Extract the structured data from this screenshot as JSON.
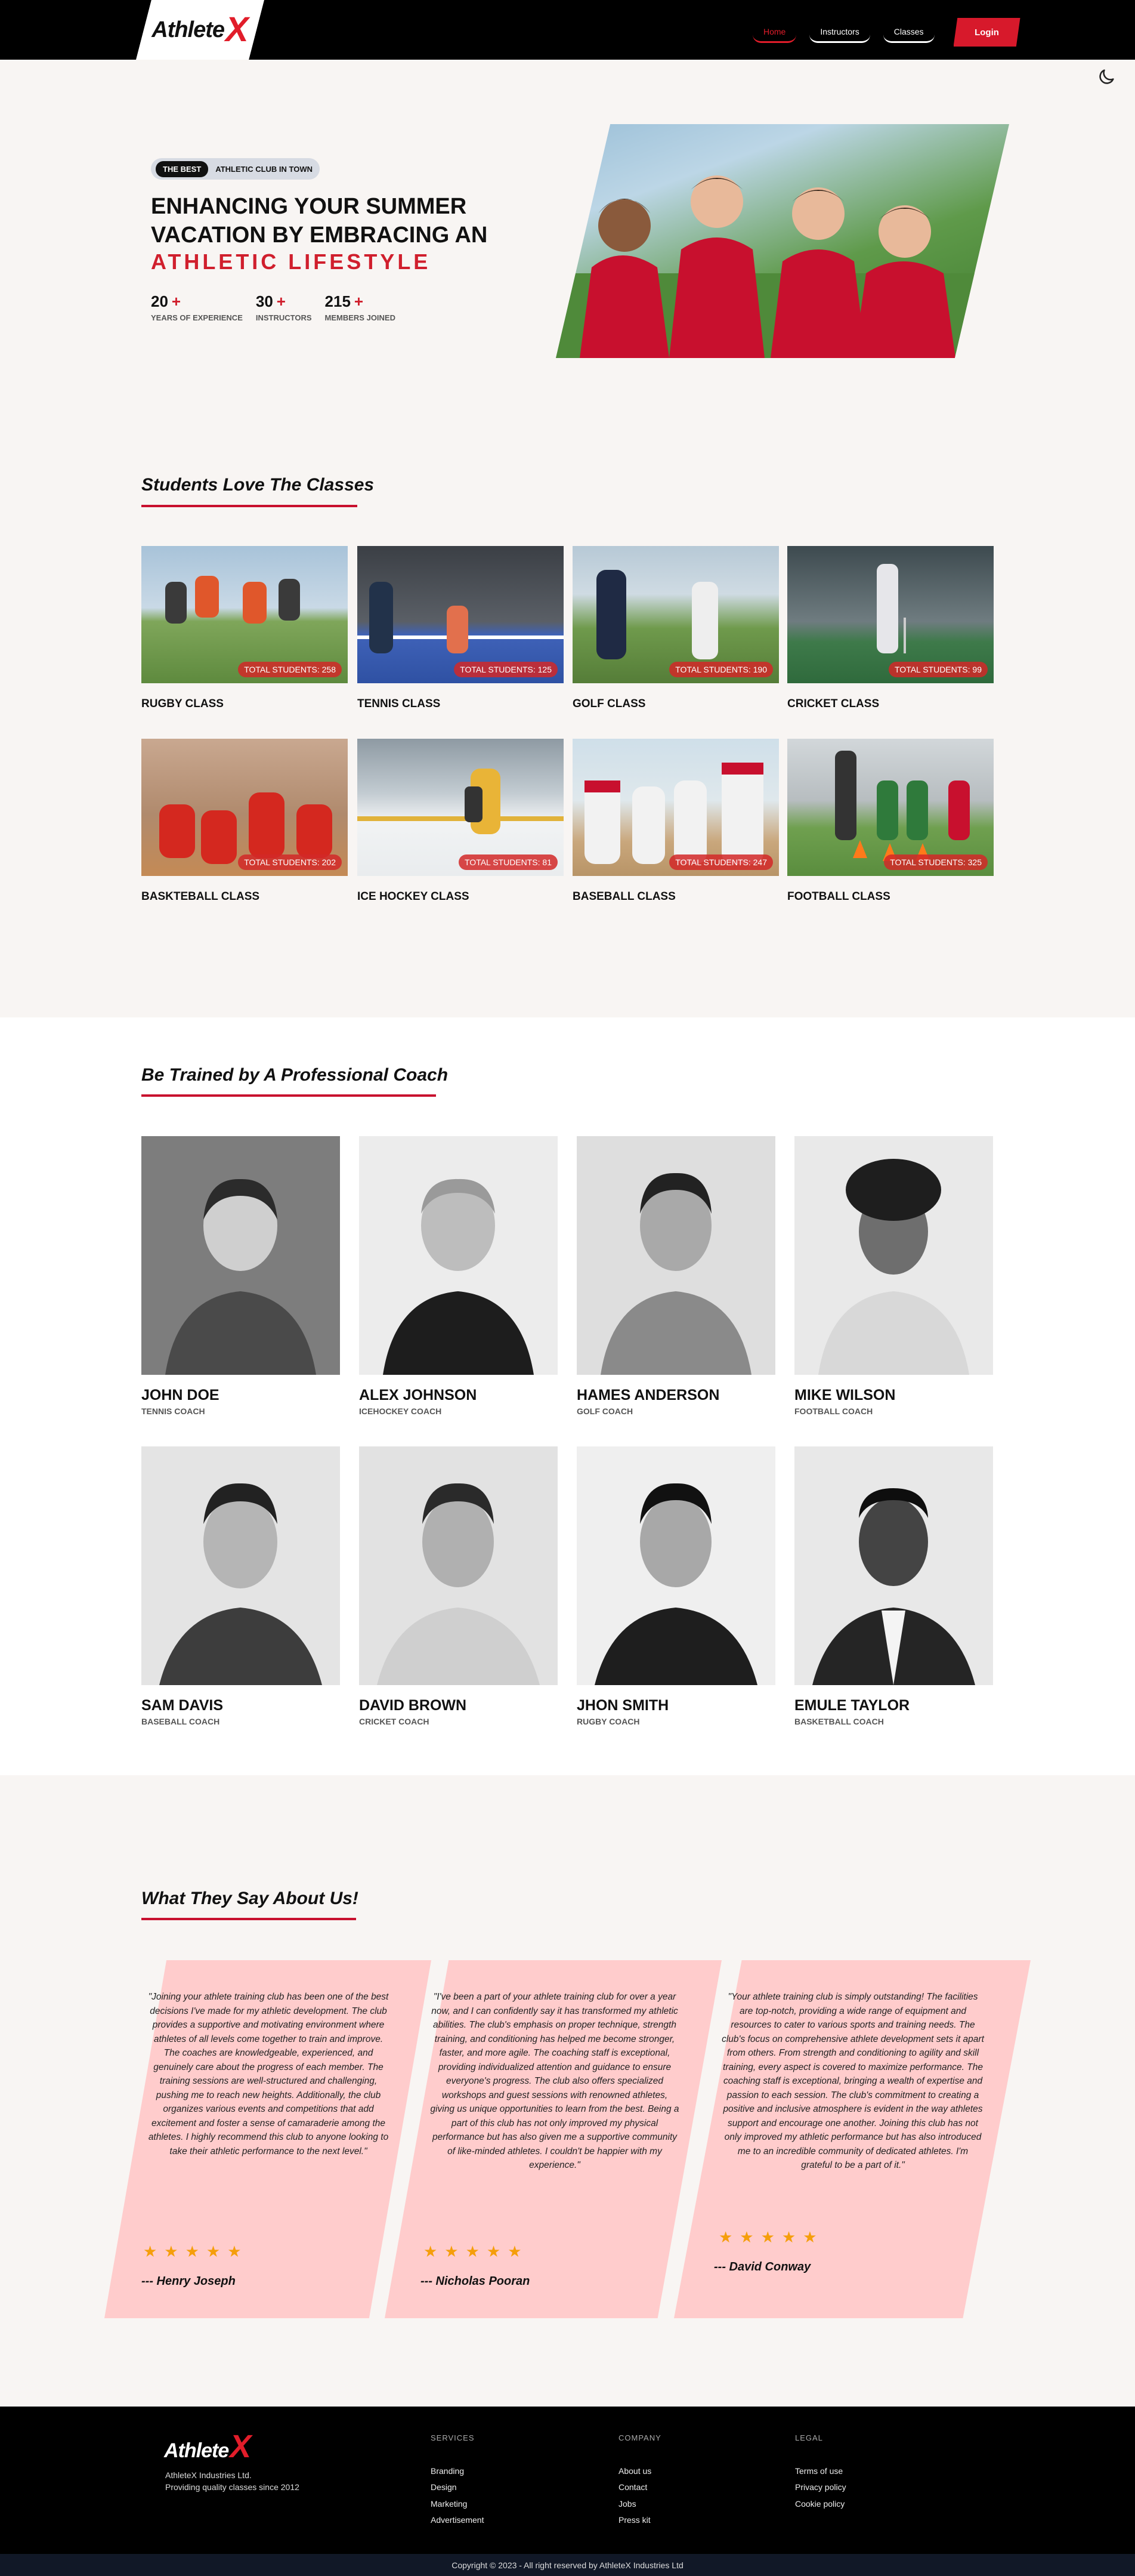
{
  "nav": {
    "logo_text": "Athlete",
    "logo_x": "X",
    "links": [
      "Home",
      "Instructors",
      "Classes"
    ],
    "login": "Login"
  },
  "hero": {
    "badge_pill": "THE BEST",
    "badge_text": "ATHLETIC CLUB IN TOWN",
    "title_line1": "ENHANCING YOUR SUMMER",
    "title_line2": "VACATION BY EMBRACING AN",
    "accent": "ATHLETIC LIFESTYLE",
    "stats": [
      {
        "num": "20",
        "plus": "+",
        "label": "YEARS OF EXPERIENCE"
      },
      {
        "num": "30",
        "plus": "+",
        "label": "INSTRUCTORS"
      },
      {
        "num": "215",
        "plus": "+",
        "label": "MEMBERS JOINED"
      }
    ]
  },
  "classes": {
    "title": "Students Love The Classes",
    "items": [
      {
        "name": "RUGBY CLASS",
        "badge": "TOTAL STUDENTS: 258"
      },
      {
        "name": "TENNIS CLASS",
        "badge": "TOTAL STUDENTS: 125"
      },
      {
        "name": "GOLF CLASS",
        "badge": "TOTAL STUDENTS: 190"
      },
      {
        "name": "CRICKET CLASS",
        "badge": "TOTAL STUDENTS: 99"
      },
      {
        "name": "BASKTEBALL CLASS",
        "badge": "TOTAL STUDENTS: 202"
      },
      {
        "name": "ICE HOCKEY CLASS",
        "badge": "TOTAL STUDENTS: 81"
      },
      {
        "name": "BASEBALL CLASS",
        "badge": "TOTAL STUDENTS: 247"
      },
      {
        "name": "FOOTBALL CLASS",
        "badge": "TOTAL STUDENTS: 325"
      }
    ]
  },
  "coaches": {
    "title": "Be Trained by A Professional Coach",
    "items": [
      {
        "name": "JOHN DOE",
        "role": "TENNIS COACH"
      },
      {
        "name": "ALEX JOHNSON",
        "role": "ICEHOCKEY COACH"
      },
      {
        "name": "HAMES ANDERSON",
        "role": "GOLF COACH"
      },
      {
        "name": "MIKE WILSON",
        "role": "FOOTBALL COACH"
      },
      {
        "name": "SAM DAVIS",
        "role": "BASEBALL COACH"
      },
      {
        "name": "DAVID BROWN",
        "role": "CRICKET COACH"
      },
      {
        "name": "JHON SMITH",
        "role": "RUGBY COACH"
      },
      {
        "name": "EMULE TAYLOR",
        "role": "BASKETBALL COACH"
      }
    ]
  },
  "testimonials": {
    "title": "What They Say About Us!",
    "stars": "★★★★★",
    "items": [
      {
        "quote": "\"Joining your athlete training club has been one of the best decisions I've made for my athletic development. The club provides a supportive and motivating environment where athletes of all levels come together to train and improve. The coaches are knowledgeable, experienced, and genuinely care about the progress of each member. The training sessions are well-structured and challenging, pushing me to reach new heights. Additionally, the club organizes various events and competitions that add excitement and foster a sense of camaraderie among the athletes. I highly recommend this club to anyone looking to take their athletic performance to the next level.\"",
        "author": "--- Henry Joseph"
      },
      {
        "quote": "\"I've been a part of your athlete training club for over a year now, and I can confidently say it has transformed my athletic abilities. The club's emphasis on proper technique, strength training, and conditioning has helped me become stronger, faster, and more agile. The coaching staff is exceptional, providing individualized attention and guidance to ensure everyone's progress. The club also offers specialized workshops and guest sessions with renowned athletes, giving us unique opportunities to learn from the best. Being a part of this club has not only improved my physical performance but has also given me a supportive community of like-minded athletes. I couldn't be happier with my experience.\"",
        "author": "--- Nicholas Pooran"
      },
      {
        "quote": "\"Your athlete training club is simply outstanding! The facilities are top-notch, providing a wide range of equipment and resources to cater to various sports and training needs. The club's focus on comprehensive athlete development sets it apart from others. From strength and conditioning to agility and skill training, every aspect is covered to maximize performance. The coaching staff is exceptional, bringing a wealth of expertise and passion to each session. The club's commitment to creating a positive and inclusive atmosphere is evident in the way athletes support and encourage one another. Joining this club has not only improved my athletic performance but has also introduced me to an incredible community of dedicated athletes. I'm grateful to be a part of it.\"",
        "author": "--- David Conway"
      }
    ]
  },
  "footer": {
    "company_line": "AthleteX Industries Ltd.",
    "tagline": "Providing quality classes since 2012",
    "columns": [
      {
        "title": "SERVICES",
        "items": [
          "Branding",
          "Design",
          "Marketing",
          "Advertisement"
        ]
      },
      {
        "title": "COMPANY",
        "items": [
          "About us",
          "Contact",
          "Jobs",
          "Press kit"
        ]
      },
      {
        "title": "LEGAL",
        "items": [
          "Terms of use",
          "Privacy policy",
          "Cookie policy"
        ]
      }
    ],
    "copyright": "Copyright © 2023 - All right reserved by AthleteX Industries Ltd"
  }
}
